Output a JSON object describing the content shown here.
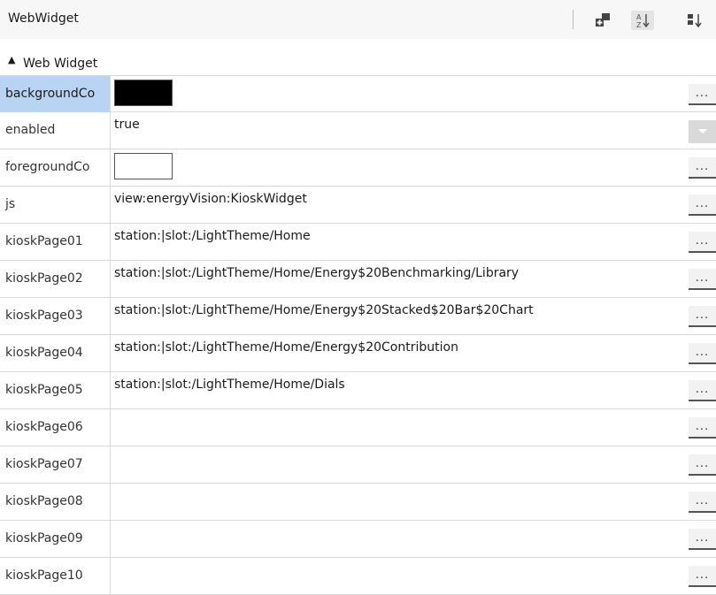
{
  "header": {
    "title": "WebWidget",
    "buttons": [
      {
        "name": "add-slot-icon"
      },
      {
        "name": "sort-az-icon"
      },
      {
        "name": "sort-order-icon"
      }
    ]
  },
  "section": {
    "arrow": "▲",
    "label": "Web Widget"
  },
  "rows": [
    {
      "name": "backgroundCo",
      "type": "color",
      "color": "#000000",
      "selected": true
    },
    {
      "name": "enabled",
      "type": "select",
      "value": "true"
    },
    {
      "name": "foregroundCo",
      "type": "color",
      "color": "#ffffff"
    },
    {
      "name": "js",
      "type": "text",
      "value": "view:energyVision:KioskWidget"
    },
    {
      "name": "kioskPage01",
      "type": "text",
      "value": "station:|slot:/LightTheme/Home"
    },
    {
      "name": "kioskPage02",
      "type": "text",
      "value": "station:|slot:/LightTheme/Home/Energy$20Benchmarking/Library"
    },
    {
      "name": "kioskPage03",
      "type": "text",
      "value": "station:|slot:/LightTheme/Home/Energy$20Stacked$20Bar$20Chart"
    },
    {
      "name": "kioskPage04",
      "type": "text",
      "value": "station:|slot:/LightTheme/Home/Energy$20Contribution"
    },
    {
      "name": "kioskPage05",
      "type": "text",
      "value": "station:|slot:/LightTheme/Home/Dials"
    },
    {
      "name": "kioskPage06",
      "type": "text",
      "value": ""
    },
    {
      "name": "kioskPage07",
      "type": "text",
      "value": ""
    },
    {
      "name": "kioskPage08",
      "type": "text",
      "value": ""
    },
    {
      "name": "kioskPage09",
      "type": "text",
      "value": ""
    },
    {
      "name": "kioskPage10",
      "type": "text",
      "value": ""
    }
  ],
  "ellipsis_label": "..."
}
